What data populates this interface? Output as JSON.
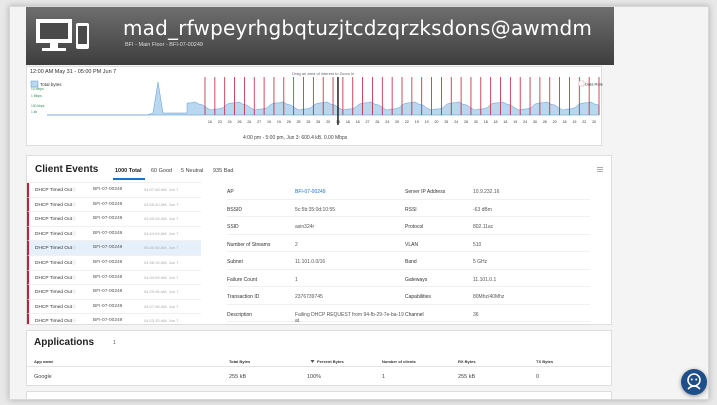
{
  "header": {
    "title": "mad_rfwpeyrhgbqtuzjtcdzqrzksdons@awmdm",
    "subtitle": "BFI - Main Floor - BFI-07-00249"
  },
  "timeline": {
    "date_range": "12:00 AM May 31 - 05:00 PM Jun 7",
    "zoom_hint": "Drag an area of interest to Zoom In",
    "legend_label": "Total bytes",
    "y_labels": [
      "10 Mbps",
      "1 Mbps",
      "100 kbps",
      "1 kb"
    ],
    "data_rate_label": "Data Rate",
    "day_labels": [
      "16",
      "23",
      "24",
      "26",
      "24",
      "27",
      "19",
      "19",
      "26",
      "25",
      "25",
      "26",
      "20",
      "18",
      "18",
      "18",
      "27",
      "26",
      "24",
      "29",
      "22",
      "19",
      "19",
      "20",
      "25",
      "24",
      "28",
      "30",
      "18",
      "18",
      "18",
      "19",
      "24",
      "30",
      "26",
      "20",
      "18",
      "19",
      "22",
      "20"
    ],
    "summary": "4:00 pm - 5:00 pm, Jun 3: 600.4 kB, 0.00 Mbps",
    "colors": {
      "event_line": "#c41e3a",
      "traffic_fill": "#b9d7ee",
      "traffic_line": "#5b9bd5",
      "cursor": "#111111"
    }
  },
  "client_events": {
    "title": "Client Events",
    "tabs": [
      {
        "label": "1000 Total",
        "active": true
      },
      {
        "label": "60 Good",
        "active": false
      },
      {
        "label": "5 Neutral",
        "active": false
      },
      {
        "label": "935 Bad",
        "active": false
      }
    ],
    "events": [
      {
        "type": "DHCP Timed Out",
        "ap": "BFI-07-00249",
        "time": "04:57:48 AM, Jun 7"
      },
      {
        "type": "DHCP Timed Out",
        "ap": "BFI-07-00249",
        "time": "04:55:40 AM, Jun 7"
      },
      {
        "type": "DHCP Timed Out",
        "ap": "BFI-07-00249",
        "time": "04:49:26 AM, Jun 7"
      },
      {
        "type": "DHCP Timed Out",
        "ap": "BFI-07-00249",
        "time": "04:44:04 AM, Jun 7"
      },
      {
        "type": "DHCP Timed Out",
        "ap": "BFI-07-00249",
        "time": "04:40:40 AM, Jun 7",
        "selected": true
      },
      {
        "type": "DHCP Timed Out",
        "ap": "BFI-07-00249",
        "time": "04:36:15 AM, Jun 7"
      },
      {
        "type": "DHCP Timed Out",
        "ap": "BFI-07-00249",
        "time": "04:34:05 AM, Jun 7"
      },
      {
        "type": "DHCP Timed Out",
        "ap": "BFI-07-00249",
        "time": "04:29:46 AM, Jun 7"
      },
      {
        "type": "DHCP Timed Out",
        "ap": "BFI-07-00249",
        "time": "04:27:36 AM, Jun 7"
      },
      {
        "type": "DHCP Timed Out",
        "ap": "BFI-07-00249",
        "time": "04:23:15 AM, Jun 7"
      }
    ],
    "details_left": [
      {
        "label": "AP",
        "value": "BFI-07-00249",
        "link": true
      },
      {
        "label": "BSSID",
        "value": "5c:5b:35:0d:10:55"
      },
      {
        "label": "SSID",
        "value": "asin324r"
      },
      {
        "label": "Number of Streams",
        "value": "2"
      },
      {
        "label": "Subnet",
        "value": "11.101.0.0/16"
      },
      {
        "label": "Failure Count",
        "value": "1"
      },
      {
        "label": "Transaction ID",
        "value": "2376739745"
      },
      {
        "label": "Description",
        "value": "Failing DHCP REQUEST from 94-fb-29-7e-ba-19 at"
      }
    ],
    "details_right": [
      {
        "label": "Server IP Address",
        "value": "10.9.232.16"
      },
      {
        "label": "RSSI",
        "value": "-63 dBm"
      },
      {
        "label": "Protocol",
        "value": "802.11ac"
      },
      {
        "label": "VLAN",
        "value": "510"
      },
      {
        "label": "Band",
        "value": "5 GHz"
      },
      {
        "label": "Gateways",
        "value": "11.101.0.1"
      },
      {
        "label": "Capabilities",
        "value": "80Mhz/40Mhz"
      },
      {
        "label": "Channel",
        "value": "36"
      }
    ]
  },
  "applications": {
    "title": "Applications",
    "count": "1",
    "columns": [
      "App name",
      "Total Bytes",
      "Percent Bytes",
      "Number of clients",
      "RX Bytes",
      "TX Bytes"
    ],
    "rows": [
      {
        "app": "Google",
        "total": "255 kB",
        "percent": "100%",
        "clients": "1",
        "rx": "255 kB",
        "tx": "0"
      }
    ]
  },
  "icons": {
    "header_device": "desktop-and-phone-icon",
    "menu": "hamburger-menu-icon",
    "info": "info-icon",
    "sort": "sort-down-icon",
    "assistant": "assistant-bot-icon"
  }
}
